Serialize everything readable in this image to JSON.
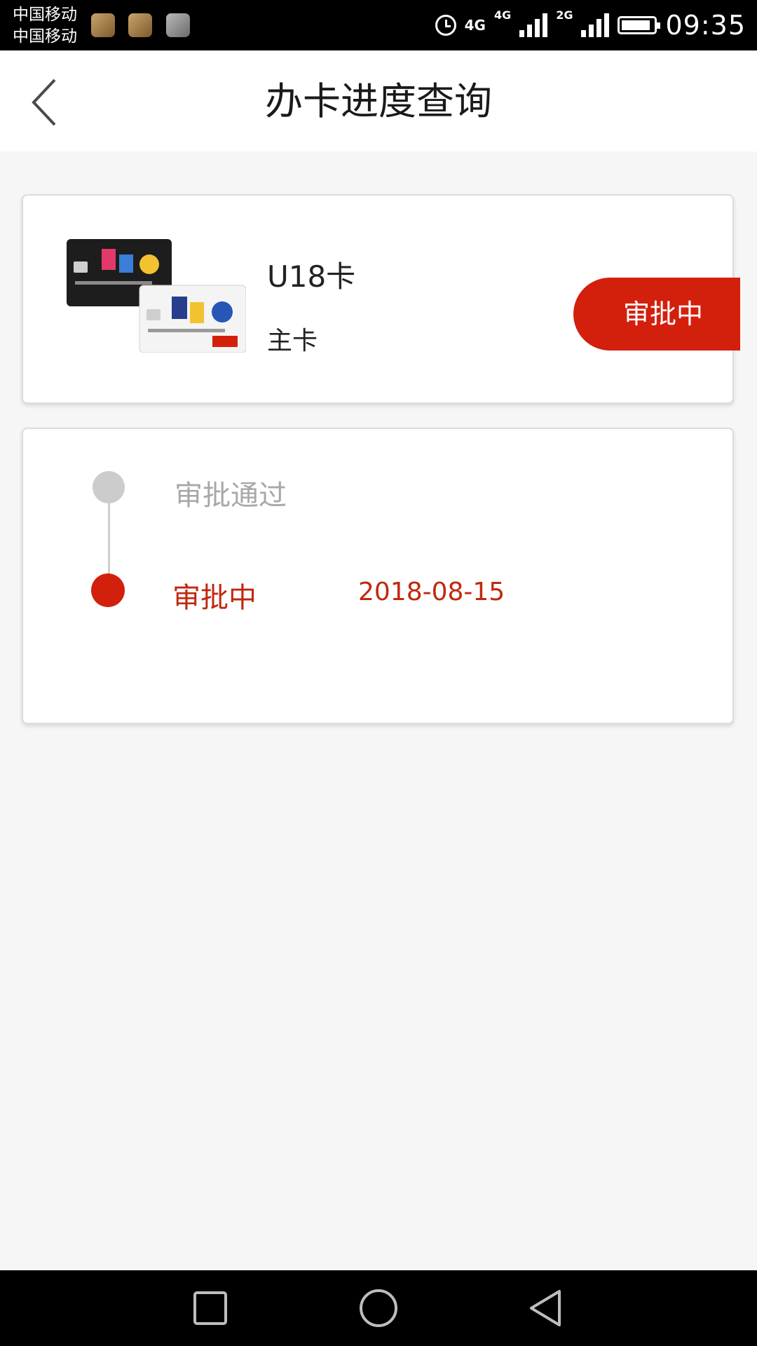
{
  "status_bar": {
    "carrier_1": "中国移动",
    "carrier_2": "中国移动",
    "network_1": "4G",
    "network_2": "4G",
    "network_3": "2G",
    "time": "09:35",
    "icons": [
      "health-app-icon",
      "document-app-icon",
      "photo-app-icon",
      "alarm-icon",
      "signal-icon",
      "battery-icon"
    ]
  },
  "header": {
    "title": "办卡进度查询",
    "back_icon": "chevron-left-icon"
  },
  "card": {
    "name": "U18卡",
    "type": "主卡",
    "status": "审批中",
    "image_icon": "credit-card-image"
  },
  "progress": {
    "steps": [
      {
        "label": "审批通过",
        "date": "",
        "state": "done"
      },
      {
        "label": "审批中",
        "date": "2018-08-15",
        "state": "current"
      }
    ]
  },
  "nav_bar": {
    "icons": [
      "recent-apps-icon",
      "home-icon",
      "back-icon"
    ]
  },
  "colors": {
    "accent": "#d3200d",
    "accent_text": "#c0280f",
    "inactive": "#cccccc",
    "background": "#f6f6f6"
  }
}
